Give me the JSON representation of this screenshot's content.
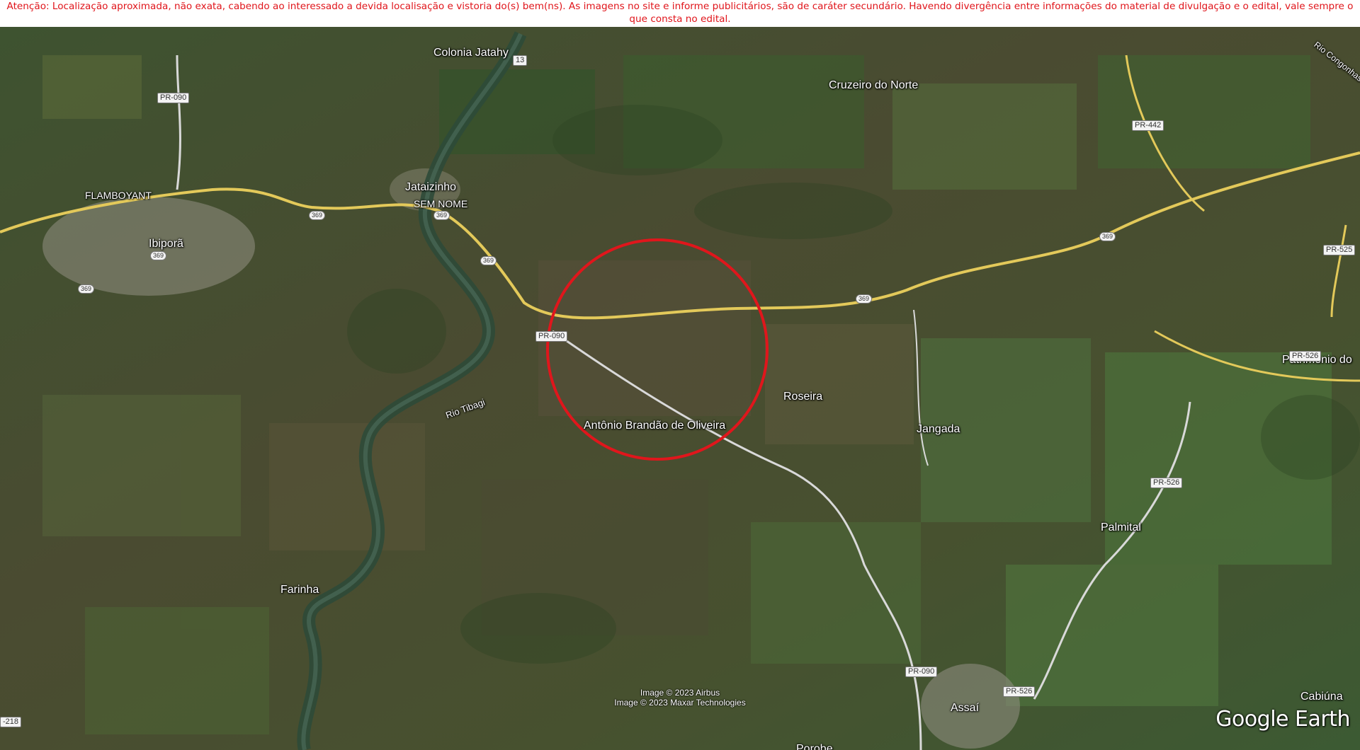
{
  "notice": "Atenção: Localização aproximada, não exata, cabendo ao interessado a devida localisação e vistoria do(s) bem(ns). As imagens no site e informe publicitários, são de caráter secundário. Havendo divergência entre informações do material de divulgação e o edital, vale sempre o que consta no edital.",
  "places": {
    "colonia_jatahy": "Colonia Jatahy",
    "cruzeiro_do_norte": "Cruzeiro do Norte",
    "flamboyant": "FLAMBOYANT",
    "jataizinho": "Jataizinho",
    "sem_nome": "SEM NOME",
    "ibipora": "Ibiporã",
    "roseira": "Roseira",
    "jangada": "Jangada",
    "antonio_brandao": "Antônio Brandão de Oliveira",
    "patrimonio": "Patrimônio do",
    "palmital": "Palmital",
    "farinha": "Farinha",
    "cabiuna": "Cabiúna",
    "assai": "Assaí",
    "porobe": "Porobe"
  },
  "rivers": {
    "tibagi": "Rio Tibagi",
    "congonhas": "Rio Congonhas"
  },
  "roads": {
    "pr090_a": "PR-090",
    "pr090_b": "PR-090",
    "pr090_c": "PR-090",
    "pr442": "PR-442",
    "pr525": "PR-525",
    "pr526_a": "PR-526",
    "pr526_b": "PR-526",
    "pr526_c": "PR-526",
    "pr218": "-218",
    "r369_a": "369",
    "r369_b": "369",
    "r369_c": "369",
    "r369_d": "369",
    "r369_e": "369",
    "r369_f": "369",
    "r369_g": "369",
    "pr13": "13"
  },
  "copyright": {
    "airbus": "Image © 2023 Airbus",
    "maxar": "Image © 2023 Maxar Technologies"
  },
  "brand": "Google Earth",
  "colors": {
    "notice_text": "#e0141a",
    "marker_circle": "#e0161c",
    "highway": "#e3c95a",
    "minor_road": "#d9d9d9"
  },
  "icons": {
    "marker": "red-circle-marker"
  }
}
